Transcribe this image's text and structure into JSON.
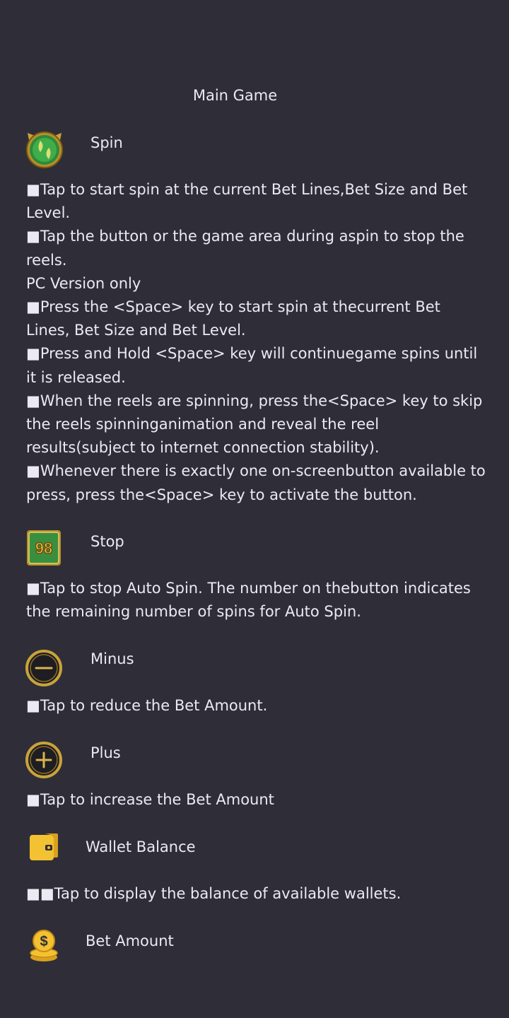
{
  "page": {
    "title": "Main Game"
  },
  "sections": {
    "spin": {
      "icon": "spin-button-icon",
      "label": "Spin",
      "desc": "■Tap to start spin at the current Bet Lines,Bet Size and Bet Level.\n■Tap the button or the game area during aspin to stop the reels.\nPC Version only\n■Press the <Space> key to start spin at thecurrent Bet Lines, Bet Size and Bet Level.\n■Press and Hold <Space> key will continuegame spins until it is released.\n■When the reels are spinning, press the<Space> key to skip the reels spinninganimation and reveal the reel results(subject to internet connection stability).\n■Whenever there is exactly one on-screenbutton available to press, press the<Space> key to activate the button."
    },
    "stop": {
      "icon": "autospin-counter-icon",
      "icon_text": "98",
      "label": "Stop",
      "desc": "■Tap to stop Auto Spin. The number on thebutton indicates the remaining number of spins for Auto Spin."
    },
    "minus": {
      "icon": "minus-circle-icon",
      "label": "Minus",
      "desc": "■Tap to reduce the Bet Amount."
    },
    "plus": {
      "icon": "plus-circle-icon",
      "label": "Plus",
      "desc": "■Tap to increase the Bet Amount"
    },
    "wallet": {
      "icon": "wallet-icon",
      "label": "Wallet Balance",
      "desc": "■■Tap to display the balance of available wallets."
    },
    "bet": {
      "icon": "coin-stack-icon",
      "label": "Bet Amount"
    }
  },
  "colors": {
    "background": "#2f2e38",
    "text": "#ece9f2",
    "gold": "#c9a33a",
    "green": "#2e8a3a",
    "wallet_yellow": "#f3c232"
  }
}
